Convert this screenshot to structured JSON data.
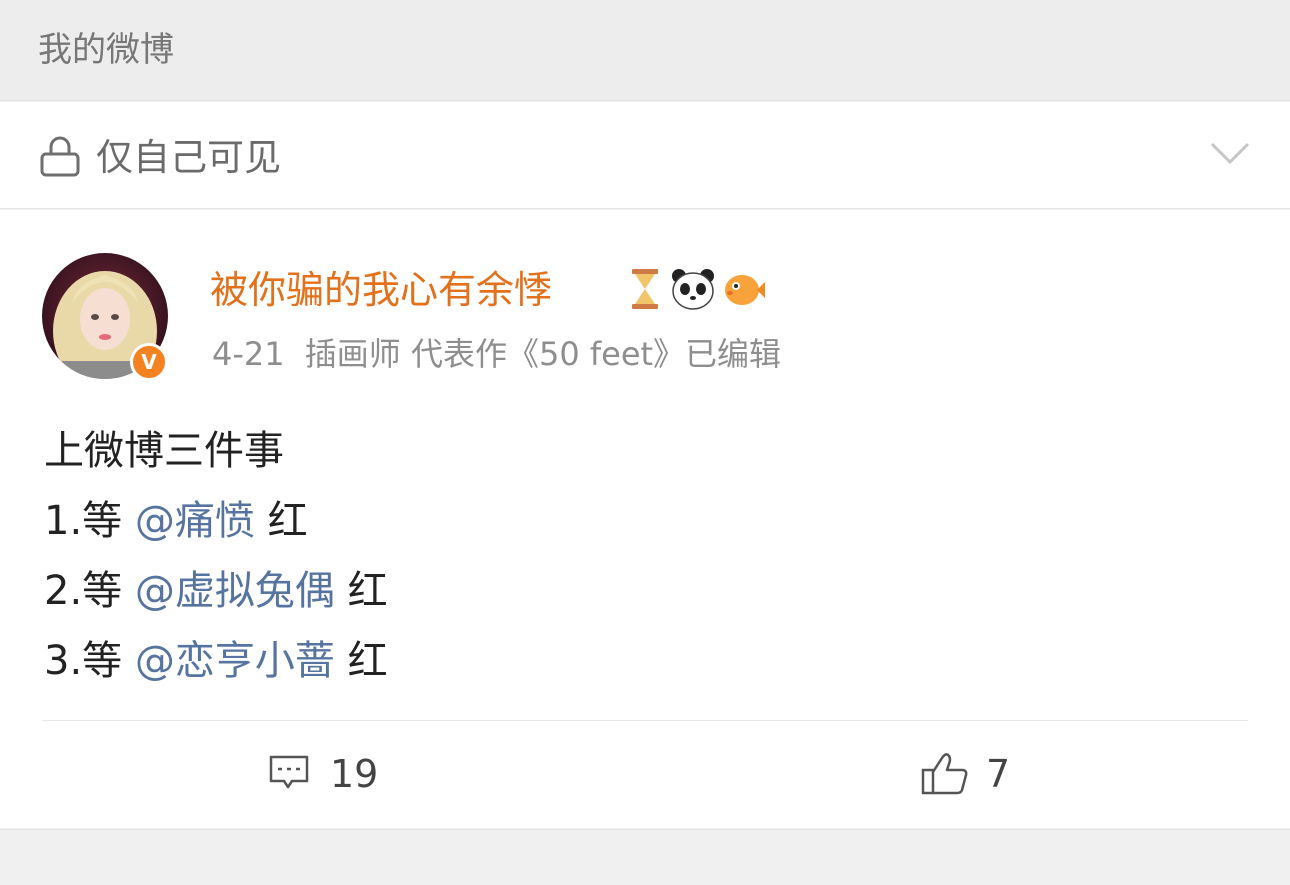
{
  "header": {
    "title": "我的微博"
  },
  "privacy": {
    "label": "仅自己可见",
    "icon": "lock-icon",
    "expand_icon": "chevron-down-icon"
  },
  "post": {
    "author": "被你骗的我心有余悸",
    "author_color": "#e3701a",
    "verified_badge": "V",
    "name_emojis": [
      "hourglass-icon",
      "panda-icon",
      "puffer-fish-icon"
    ],
    "date": "4-21",
    "author_bio": "插画师 代表作《50 feet》已编辑",
    "content": {
      "line1": "上微博三件事",
      "items": [
        {
          "prefix": "1.等 ",
          "mention": "@痛愤",
          "suffix": " 红"
        },
        {
          "prefix": "2.等 ",
          "mention": "@虚拟兔偶",
          "suffix": " 红"
        },
        {
          "prefix": "3.等 ",
          "mention": "@恋亨小蔷",
          "suffix": " 红"
        }
      ]
    },
    "mention_color": "#56749f",
    "comments": "19",
    "likes": "7"
  }
}
